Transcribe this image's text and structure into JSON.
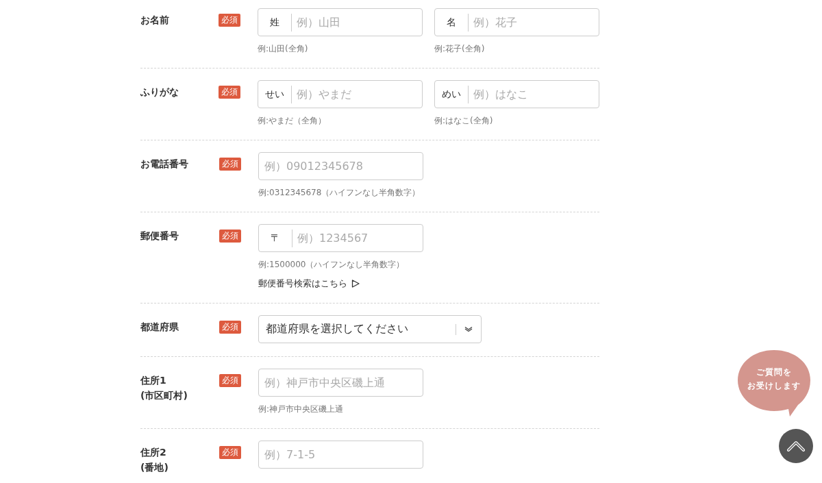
{
  "rows": [
    {
      "kind": "pair",
      "label": [
        "お名前"
      ],
      "badge": "必須",
      "fields": [
        {
          "prefix": "姓",
          "placeholder": "例）山田",
          "hint": "例:山田(全角)"
        },
        {
          "prefix": "名",
          "placeholder": "例）花子",
          "hint": "例:花子(全角)"
        }
      ]
    },
    {
      "kind": "pair",
      "label": [
        "ふりがな"
      ],
      "badge": "必須",
      "fields": [
        {
          "prefix": "せい",
          "placeholder": "例）やまだ",
          "hint": "例:やまだ（全角）"
        },
        {
          "prefix": "めい",
          "placeholder": "例）はなこ",
          "hint": "例:はなこ(全角)"
        }
      ]
    },
    {
      "kind": "single",
      "label": [
        "お電話番号"
      ],
      "badge": "必須",
      "fields": [
        {
          "placeholder": "例）09012345678",
          "hint": "例:0312345678（ハイフンなし半角数字）"
        }
      ]
    },
    {
      "kind": "single",
      "label": [
        "郵便番号"
      ],
      "badge": "必須",
      "fields": [
        {
          "prefix": "〒",
          "placeholder": "例）1234567",
          "hint": "例:1500000（ハイフンなし半角数字）"
        }
      ],
      "link": "郵便番号検索はこちら"
    },
    {
      "kind": "select",
      "label": [
        "都道府県"
      ],
      "badge": "必須",
      "value": "都道府県を選択してください"
    },
    {
      "kind": "single",
      "label": [
        "住所1",
        "(市区町村)"
      ],
      "badge": "必須",
      "fields": [
        {
          "placeholder": "例）神戸市中央区磯上通",
          "hint": "例:神戸市中央区磯上通"
        }
      ]
    },
    {
      "kind": "single",
      "label": [
        "住所2",
        "(番地)"
      ],
      "badge": "必須",
      "fields": [
        {
          "placeholder": "例）7-1-5"
        }
      ]
    }
  ],
  "help_bubble": {
    "lines": [
      "ご質問を",
      "お受けします"
    ]
  }
}
